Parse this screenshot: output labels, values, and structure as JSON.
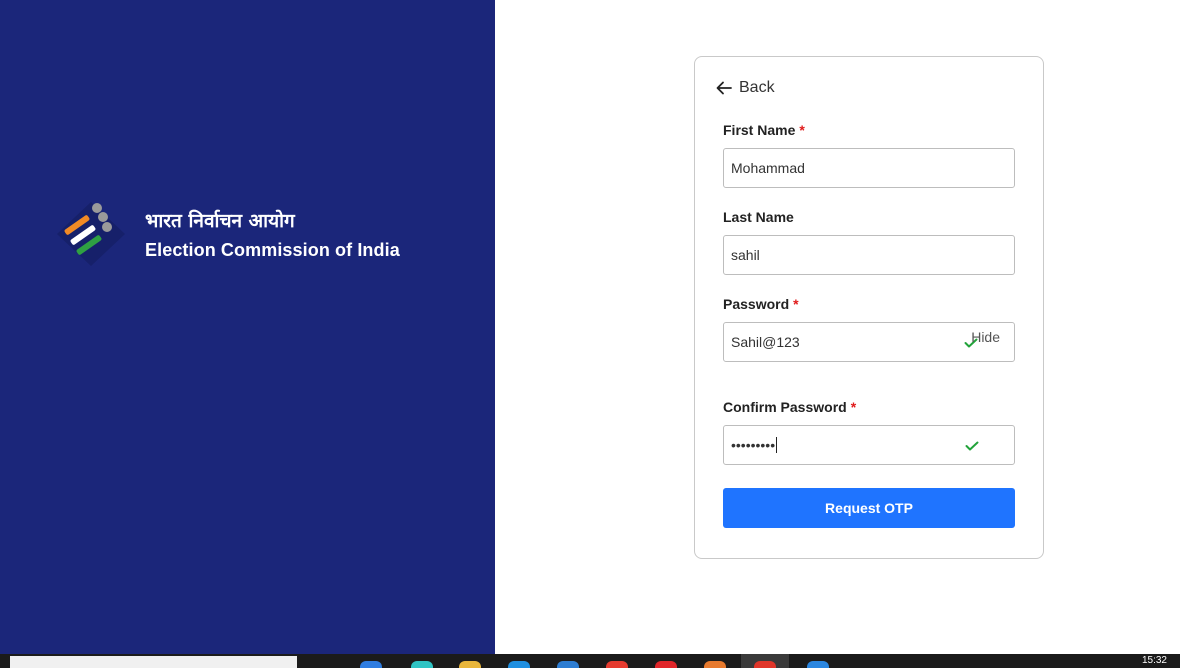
{
  "brand": {
    "hindi_name": "भारत निर्वाचन आयोग",
    "english_name": "Election Commission of India",
    "logo_icon": "eci-ballot-finger-logo"
  },
  "form": {
    "back_label": "Back",
    "first_name": {
      "label": "First Name",
      "required_mark": "*",
      "value": "Mohammad"
    },
    "last_name": {
      "label": "Last Name",
      "value": "sahil"
    },
    "password": {
      "label": "Password",
      "required_mark": "*",
      "value": "Sahil@123",
      "toggle_label": "Hide",
      "valid_icon": "check-icon"
    },
    "confirm_password": {
      "label": "Confirm Password",
      "required_mark": "*",
      "value": "•••••••••",
      "valid_icon": "check-icon"
    },
    "submit_label": "Request OTP"
  },
  "colors": {
    "left_panel_bg": "#1b267a",
    "primary_button": "#1f74ff",
    "required_mark": "#e01b1b",
    "valid_check": "#22a33a"
  },
  "taskbar": {
    "clock": "15:32"
  }
}
